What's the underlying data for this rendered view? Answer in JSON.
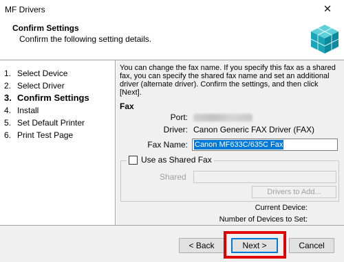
{
  "window": {
    "title": "MF Drivers",
    "close_glyph": "✕"
  },
  "header": {
    "title": "Confirm Settings",
    "subtitle": "Confirm the following setting details."
  },
  "steps": [
    {
      "num": "1.",
      "label": "Select Device"
    },
    {
      "num": "2.",
      "label": "Select Driver"
    },
    {
      "num": "3.",
      "label": "Confirm Settings"
    },
    {
      "num": "4.",
      "label": "Install"
    },
    {
      "num": "5.",
      "label": "Set Default Printer"
    },
    {
      "num": "6.",
      "label": "Print Test Page"
    }
  ],
  "main": {
    "description": "You can change the fax name. If you specify this fax as a shared fax, you can specify the shared fax name and set an additional driver (alternate driver). Confirm the settings, and then click [Next].",
    "section_title": "Fax",
    "port_label": "Port:",
    "driver_label": "Driver:",
    "driver_value": "Canon Generic FAX Driver (FAX)",
    "fax_name_label": "Fax Name:",
    "fax_name_value": "Canon MF633C/635C Fax",
    "shared_fax_checkbox_label": "Use as Shared Fax",
    "shared_label": "Shared",
    "drivers_to_add_label": "Drivers to Add...",
    "current_device_label": "Current Device:",
    "devices_to_set_label": "Number of Devices to Set:"
  },
  "footer": {
    "back_label": "< Back",
    "next_label": "Next >",
    "cancel_label": "Cancel"
  },
  "colors": {
    "accent": "#0078d7",
    "highlight": "#e00000"
  }
}
